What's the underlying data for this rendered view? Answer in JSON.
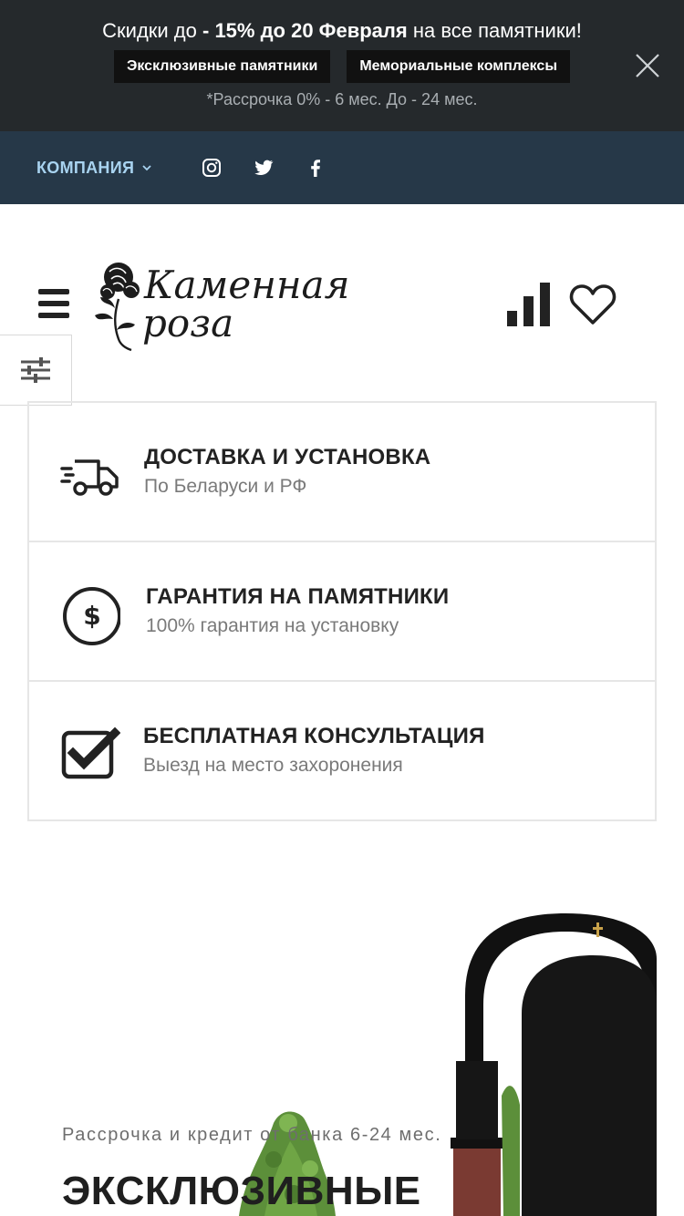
{
  "promo": {
    "text_before": "Скидки до ",
    "text_bold": "- 15% до 20 Февраля",
    "text_after": " на все памятники!",
    "buttons": [
      {
        "label": "Эксклюзивные памятники"
      },
      {
        "label": "Мемориальные комплексы"
      }
    ],
    "note": "*Рассрочка 0% - 6 мес. До - 24 мес."
  },
  "topnav": {
    "company_label": "КОМПАНИЯ",
    "social_icons": [
      "instagram-icon",
      "twitter-icon",
      "facebook-icon"
    ]
  },
  "header": {
    "logo_line1": "Каменная",
    "logo_line2": "роза"
  },
  "features": [
    {
      "icon": "truck-icon",
      "title": "ДОСТАВКА И УСТАНОВКА",
      "subtitle": "По Беларуси и РФ"
    },
    {
      "icon": "dollar-circle-icon",
      "title": "ГАРАНТИЯ НА ПАМЯТНИКИ",
      "subtitle": "100% гарантия на установку"
    },
    {
      "icon": "checkbox-icon",
      "title": "БЕСПЛАТНАЯ КОНСУЛЬТАЦИЯ",
      "subtitle": "Выезд на место захоронения"
    }
  ],
  "hero": {
    "subtitle": "Рассрочка и кредит от банка 6-24 мес.",
    "title": "ЭКСКЛЮЗИВНЫЕ"
  },
  "colors": {
    "promo_bg": "#25292c",
    "nav_bg": "#263848",
    "nav_text": "#a8d3f0",
    "accent_dark": "#222222"
  }
}
